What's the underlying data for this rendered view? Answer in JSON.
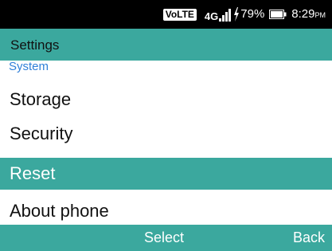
{
  "status_bar": {
    "volte_label": "VoLTE",
    "network_label": "4G",
    "battery_percent": "79%",
    "time": "8:29",
    "time_suffix": "PM",
    "icons": [
      "signal-icon",
      "charging-icon",
      "battery-icon"
    ]
  },
  "header": {
    "title": "Settings"
  },
  "section_label": "System",
  "menu": {
    "items": [
      {
        "label": "Storage",
        "selected": false
      },
      {
        "label": "Security",
        "selected": false
      },
      {
        "label": "Reset",
        "selected": true
      },
      {
        "label": "About phone",
        "selected": false
      }
    ]
  },
  "softkeys": {
    "center": "Select",
    "right": "Back"
  },
  "colors": {
    "accent": "#3ba89e",
    "section_label": "#2f7fd8",
    "status_bar_bg": "#000000",
    "text": "#111111"
  }
}
